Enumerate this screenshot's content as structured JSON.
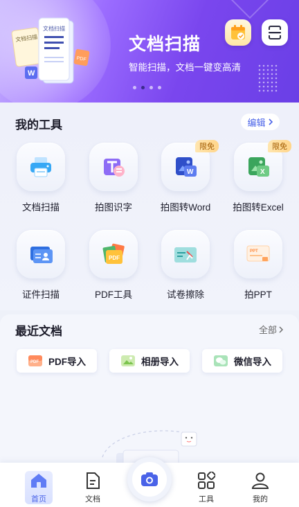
{
  "banner": {
    "title": "文档扫描",
    "subtitle": "智能扫描，文档一键变高清",
    "illustration_texts": [
      "文档扫描",
      "文档扫描",
      "PDF",
      "W"
    ],
    "carousel_count": 4,
    "carousel_active": 1
  },
  "tools": {
    "title": "我的工具",
    "edit_label": "编辑",
    "items": [
      {
        "label": "文档扫描",
        "icon": "printer-icon"
      },
      {
        "label": "拍图识字",
        "icon": "text-recognition-icon"
      },
      {
        "label": "拍图转Word",
        "icon": "word-icon",
        "badge": "限免"
      },
      {
        "label": "拍图转Excel",
        "icon": "excel-icon",
        "badge": "限免"
      },
      {
        "label": "证件扫描",
        "icon": "id-card-icon"
      },
      {
        "label": "PDF工具",
        "icon": "pdf-icon"
      },
      {
        "label": "试卷擦除",
        "icon": "exam-erase-icon"
      },
      {
        "label": "拍PPT",
        "icon": "ppt-icon"
      }
    ]
  },
  "recent": {
    "title": "最近文档",
    "all_label": "全部",
    "imports": [
      {
        "label": "PDF导入",
        "icon": "pdf-import-icon"
      },
      {
        "label": "相册导入",
        "icon": "album-import-icon"
      },
      {
        "label": "微信导入",
        "icon": "wechat-import-icon"
      }
    ]
  },
  "nav": {
    "items": [
      {
        "label": "首页",
        "icon": "home-icon"
      },
      {
        "label": "文档",
        "icon": "document-icon"
      },
      {
        "label": "工具",
        "icon": "tools-icon"
      },
      {
        "label": "我的",
        "icon": "profile-icon"
      }
    ],
    "active": 0
  },
  "colors": {
    "accent": "#4a63e8",
    "banner_start": "#c9b6ff",
    "banner_end": "#6a3fe6",
    "badge_bg": "#ffd58a",
    "badge_text": "#a15a00"
  }
}
